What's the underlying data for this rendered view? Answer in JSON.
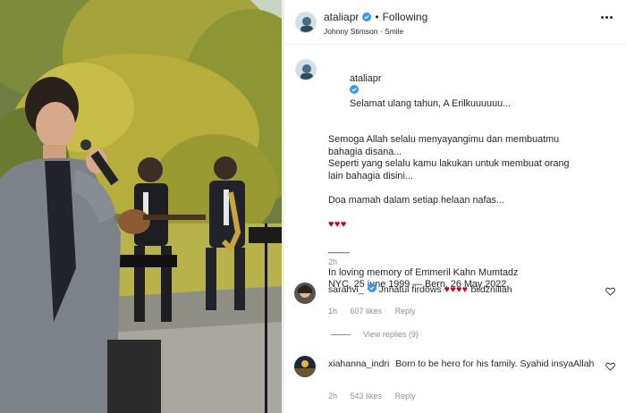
{
  "header": {
    "username": "ataliapr",
    "separator": "•",
    "follow_state": "Following",
    "audio": "Johnny Stimson · Smile"
  },
  "caption": {
    "username": "ataliapr",
    "lines": [
      "Selamat ulang tahun, A Erilkuuuuuu...",
      "",
      "Semoga Allah selalu menyayangimu dan membuatmu",
      "bahagia disana...",
      "Seperti yang selalu kamu lakukan untuk membuat orang",
      "lain bahagia disini...",
      "",
      "Doa mamah dalam setiap helaan nafas...",
      "",
      "♥♥♥",
      "",
      "____",
      "",
      "In loving memory of Emmeril Kahn Mumtadz",
      "NYC, 25 june 1999 — Bern, 26 May 2022."
    ],
    "time": "2h"
  },
  "comments": [
    {
      "username": "sarahvi_",
      "text": "Jnnatul firdows",
      "hearts": "♥♥♥♥",
      "text_after": "biidznillah",
      "time": "1h",
      "likes": "607 likes",
      "reply_label": "Reply",
      "view_replies": "View replies (9)"
    },
    {
      "username": "xiahanna_indri",
      "text": "Born to be hero for his family. Syahid insyaAllah",
      "time": "2h",
      "likes": "543 likes",
      "reply_label": "Reply"
    }
  ],
  "colors": {
    "text": "#262626",
    "muted": "#8e8e8e",
    "heart": "#c4001a",
    "verified": "#3897f0"
  },
  "icons": {
    "more": "more-options-icon",
    "verified": "verified-badge-icon",
    "like": "heart-outline-icon"
  }
}
